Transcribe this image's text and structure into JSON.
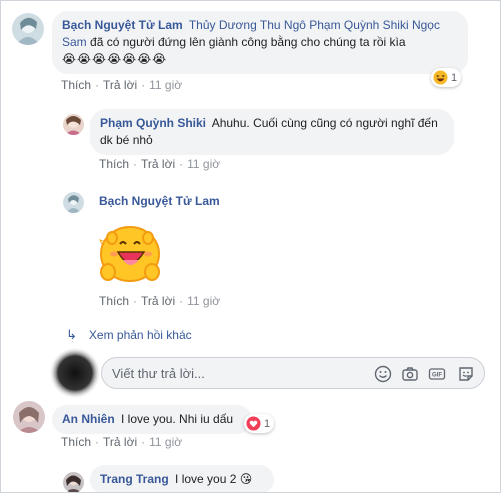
{
  "comments": [
    {
      "author": "Bạch Nguyệt Tử Lam",
      "tags": "Thủy Dương Thu Ngô Phạm Quỳnh Shiki Ngọc Sam",
      "text": "đã có người đứng lên giành công bằng cho chúng ta rồi kìa",
      "emoji": "😭😭😭😭😭😭😭",
      "reaction_count": "1",
      "reaction_icon": "haha-icon",
      "actions": {
        "like": "Thích",
        "reply": "Trả lời",
        "time": "11 giờ"
      }
    },
    {
      "author": "Phạm Quỳnh Shiki",
      "text": "Ahuhu. Cuối cùng cũng có người nghĩ đến dk bé nhỏ",
      "actions": {
        "like": "Thích",
        "reply": "Trả lời",
        "time": "11 giờ"
      }
    },
    {
      "author": "Bạch Nguyệt Tử Lam",
      "sticker": "sticker-icon",
      "actions": {
        "like": "Thích",
        "reply": "Trả lời",
        "time": "11 giờ"
      }
    },
    {
      "author": "An Nhiên",
      "text": "I love you. Nhi iu dấu",
      "reaction_count": "1",
      "reaction_icon": "love-icon",
      "actions": {
        "like": "Thích",
        "reply": "Trả lời",
        "time": "11 giờ"
      }
    },
    {
      "author": "Trang Trang",
      "text": "I love you 2 😘"
    }
  ],
  "more_replies": "Xem phản hồi khác",
  "reply_box": {
    "placeholder": "Viết thư trả lời...",
    "tools": [
      "emoji-icon",
      "camera-icon",
      "gif-icon",
      "sticker-icon"
    ]
  }
}
